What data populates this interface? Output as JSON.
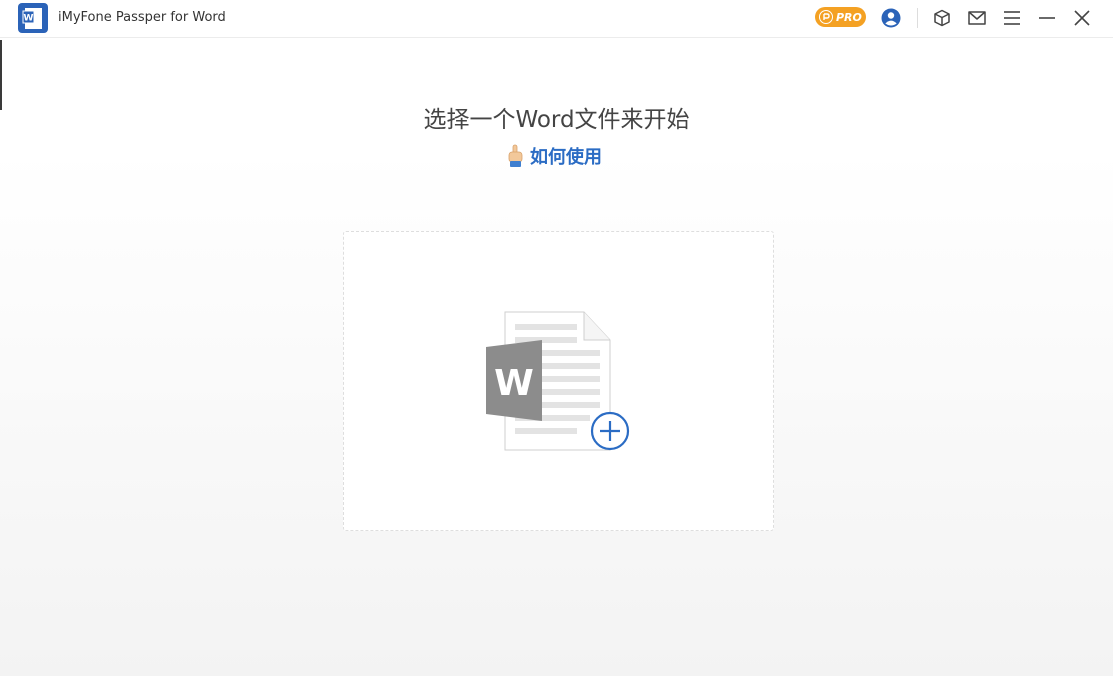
{
  "app": {
    "title": "iMyFone Passper for Word",
    "icon_letter": "W"
  },
  "titlebar": {
    "pro_label": "PRO",
    "icons": [
      "pro-badge-icon",
      "account-icon",
      "cube-icon",
      "mail-icon",
      "menu-icon",
      "minimize-icon",
      "close-icon"
    ]
  },
  "main": {
    "heading": "选择一个Word文件来开始",
    "howto_label": "如何使用",
    "dropzone_letter": "W"
  },
  "colors": {
    "accent_blue": "#2b6cc4",
    "pro_orange": "#f4a123",
    "word_gray": "#8c8c8c"
  }
}
